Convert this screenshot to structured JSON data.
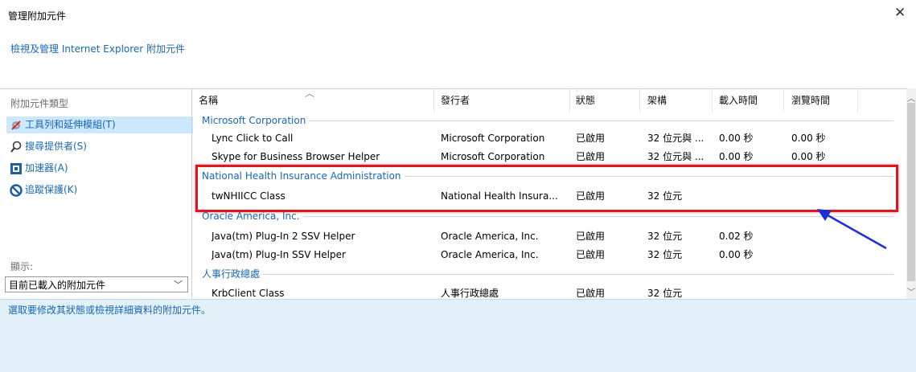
{
  "window": {
    "title": "管理附加元件",
    "subtitle": "檢視及管理 Internet Explorer 附加元件"
  },
  "left": {
    "types_label": "附加元件類型",
    "types": [
      {
        "label": "工具列和延伸模組(T)",
        "icon": "gear-icon",
        "selected": true
      },
      {
        "label": "搜尋提供者(S)",
        "icon": "search-icon",
        "selected": false
      },
      {
        "label": "加速器(A)",
        "icon": "accelerator-icon",
        "selected": false
      },
      {
        "label": "追蹤保護(K)",
        "icon": "block-icon",
        "selected": false
      }
    ],
    "show_label": "顯示:",
    "show_value": "目前已載入的附加元件"
  },
  "table": {
    "columns": [
      "名稱",
      "發行者",
      "狀態",
      "架構",
      "載入時間",
      "瀏覽時間"
    ],
    "groups": [
      {
        "name": "Microsoft Corporation",
        "rows": [
          [
            "Lync Click to Call",
            "Microsoft Corporation",
            "已啟用",
            "32 位元與 ...",
            "0.00 秒",
            "0.00 秒"
          ],
          [
            "Skype for Business Browser Helper",
            "Microsoft Corporation",
            "已啟用",
            "32 位元與 ...",
            "0.00 秒",
            "0.00 秒"
          ]
        ]
      },
      {
        "name": "National Health Insurance Administration",
        "rows": [
          [
            "twNHIICC Class",
            "National Health Insura...",
            "已啟用",
            "32 位元",
            "",
            ""
          ]
        ]
      },
      {
        "name": "Oracle America, Inc.",
        "rows": [
          [
            "Java(tm) Plug-In 2 SSV Helper",
            "Oracle America, Inc.",
            "已啟用",
            "32 位元",
            "0.02 秒",
            ""
          ],
          [
            "Java(tm) Plug-In SSV Helper",
            "Oracle America, Inc.",
            "已啟用",
            "32 位元",
            "0.00 秒",
            ""
          ]
        ]
      },
      {
        "name": "人事行政總處",
        "rows": [
          [
            "KrbClient Class",
            "人事行政總處",
            "已啟用",
            "32 位元",
            "",
            ""
          ]
        ]
      }
    ]
  },
  "footer": {
    "hint": "選取要修改其狀態或檢視詳細資料的附加元件。"
  },
  "colors": {
    "accent": "#1a66b3",
    "highlight": "#e0161e",
    "arrow": "#1f2ed6"
  }
}
